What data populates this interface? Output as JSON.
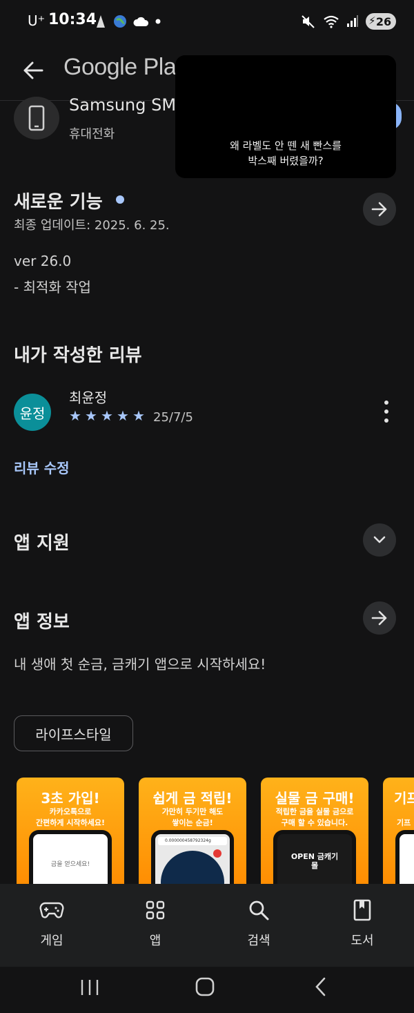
{
  "status_bar": {
    "carrier": "U⁺",
    "time": "10:34",
    "battery": "26"
  },
  "header": {
    "brand": "Google Play"
  },
  "device": {
    "name": "Samsung SM",
    "type": "휴대전화"
  },
  "popup": {
    "line1": "왜 라벨도 안 뗀 새 빤스를",
    "line2": "박스째 버렸을까?"
  },
  "whats_new": {
    "title": "새로운 기능",
    "updated": "최종 업데이트: 2025. 6. 25.",
    "version": "ver 26.0",
    "note": "- 최적화 작업"
  },
  "my_review": {
    "title": "내가 작성한 리뷰",
    "avatar_text": "윤정",
    "reviewer": "최윤정",
    "rating": 5,
    "date": "25/7/5",
    "edit_label": "리뷰 수정"
  },
  "app_support": {
    "title": "앱 지원"
  },
  "app_info": {
    "title": "앱 정보",
    "description": "내 생애 첫 순금, 금캐기 앱으로 시작하세요!",
    "category_chip": "라이프스타일"
  },
  "screenshots": [
    {
      "title": "3초 가입!",
      "sub1": "카카오톡으로",
      "sub2": "간편하게 시작하세요!",
      "screen_text": "금을 얻으세요!"
    },
    {
      "title": "쉽게 금 적립!",
      "sub1": "가만히 두기만 해도",
      "sub2": "쌓이는 순금!",
      "screen_text": "0.000000458792324g"
    },
    {
      "title": "실물 금 구매!",
      "sub1": "적립한 금을 실물 금으로",
      "sub2": "구매 할 수 있습니다.",
      "screen_text": "OPEN 금캐기 몰"
    },
    {
      "title": "기프",
      "sub1": "",
      "sub2": "기프",
      "screen_text": ""
    }
  ],
  "bottom_nav": [
    {
      "label": "게임",
      "icon": "gamepad-icon"
    },
    {
      "label": "앱",
      "icon": "apps-grid-icon"
    },
    {
      "label": "검색",
      "icon": "search-icon"
    },
    {
      "label": "도서",
      "icon": "book-icon"
    }
  ],
  "colors": {
    "background": "#131314",
    "accent": "#a8c7fa",
    "avatar": "#0b8f99",
    "screenshot_orange": "#ff9a0a"
  }
}
